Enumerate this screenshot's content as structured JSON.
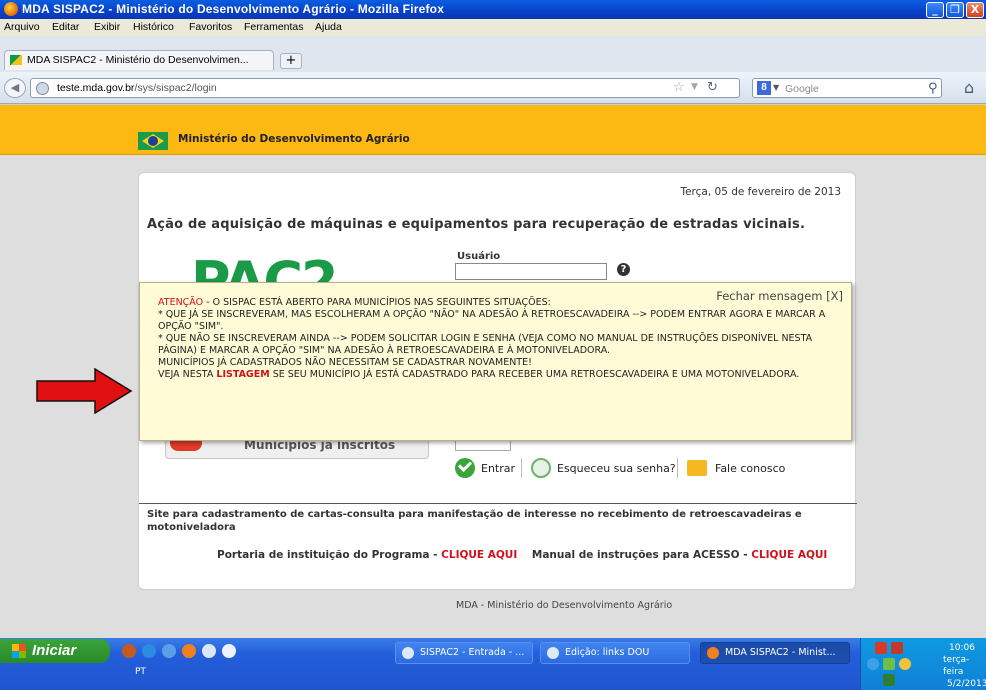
{
  "window": {
    "title": "MDA SISPAC2 - Ministério do Desenvolvimento Agrário - Mozilla Firefox",
    "minimize": "_",
    "maximize": "❐",
    "close": "X"
  },
  "menu": [
    "Arquivo",
    "Editar",
    "Exibir",
    "Histórico",
    "Favoritos",
    "Ferramentas",
    "Ajuda"
  ],
  "tab": {
    "label": "MDA SISPAC2 - Ministério do Desenvolvimen...",
    "new_tab": "+"
  },
  "nav": {
    "url_domain": "teste.mda.gov.br",
    "url_path": "/sys/sispac2/login",
    "search_placeholder": "Google",
    "search_engine_badge": "8"
  },
  "header": {
    "ministry": "Ministério do Desenvolvimento Agrário"
  },
  "page": {
    "date": "Terça, 05 de fevereiro de 2013",
    "heading": "Ação de aquisição de máquinas e equipamentos para recuperação de estradas vicinais.",
    "logo_text": "PAC2",
    "user_label": "Usuário",
    "help": "?",
    "municipios_label": "Municípios já inscritos",
    "enter": "Entrar",
    "forgot": "Esqueceu sua senha?",
    "contact": "Fale conosco",
    "site_description": "Site para cadastramento de cartas-consulta para manifestação de interesse no recebimento de retroescavadeiras e motoniveladora",
    "portaria_label": "Portaria de instituição do Programa - ",
    "manual_label": "Manual de instruções para ACESSO - ",
    "click_here": "CLIQUE AQUI",
    "footer": "MDA - Ministério do Desenvolvimento Agrário"
  },
  "modal": {
    "close": "Fechar mensagem [X]",
    "attention": "ATENÇÃO",
    "line1": " - O SISPAC ESTÁ ABERTO PARA MUNICÍPIOS NAS SEGUINTES SITUAÇÕES:",
    "line2": "* QUE JÁ SE INSCREVERAM, MAS ESCOLHERAM A OPÇÃO \"NÃO\" NA ADESÃO À RETROESCAVADEIRA --> PODEM ENTRAR AGORA E MARCAR A OPÇÃO \"SIM\".",
    "line3": "* QUE NÃO SE INSCREVERAM AINDA --> PODEM SOLICITAR LOGIN E SENHA (VEJA COMO NO MANUAL DE INSTRUÇÕES DISPONÍVEL NESTA PÁGINA) E MARCAR A OPÇÃO \"SIM\" NA ADESÃO À RETROESCAVADEIRA E À MOTONIVELADORA.",
    "line4": "MUNICÍPIOS JÁ CADASTRADOS NÃO NECESSITAM SE CADASTRAR NOVAMENTE!",
    "line5_a": "VEJA NESTA ",
    "line5_link": "LISTAGEM",
    "line5_b": " SE SEU MUNICÍPIO JÁ ESTÁ CADASTRADO PARA RECEBER UMA RETROESCAVADEIRA E UMA MOTONIVELADORA."
  },
  "taskbar": {
    "start": "Iniciar",
    "lang": "PT",
    "tasks": [
      "SISPAC2 - Entrada - ...",
      "Edição: links DOU",
      "MDA SISPAC2 - Minist..."
    ],
    "clock_time": "10:06",
    "clock_day": "terça-feira",
    "clock_date": "5/2/2013"
  },
  "colors": {
    "accent_orange": "#fcb813",
    "link_red": "#d0111b",
    "modal_bg": "#fefbd6",
    "pac_green": "#1b9a47",
    "arrow_red": "#e01010"
  }
}
